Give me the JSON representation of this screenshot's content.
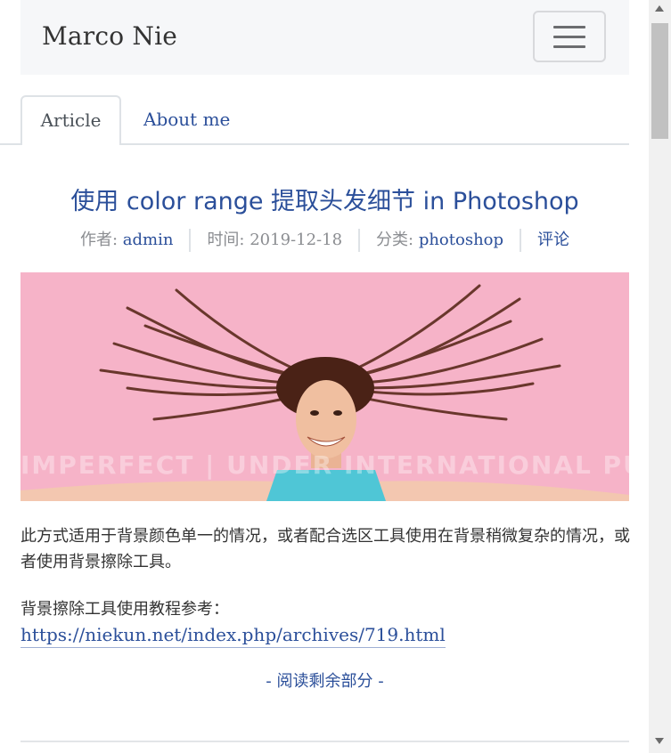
{
  "navbar": {
    "brand": "Marco Nie",
    "menu_icon": "hamburger-menu-icon"
  },
  "tabs": [
    {
      "label": "Article",
      "active": true
    },
    {
      "label": "About me",
      "active": false
    }
  ],
  "post": {
    "title": "使用 color range 提取头发细节 in Photoshop",
    "meta": {
      "author_label": "作者: ",
      "author": "admin",
      "date_label": "时间: ",
      "date": "2019-12-18",
      "category_label": "分类: ",
      "category": "photoshop",
      "comments": "评论"
    },
    "image": {
      "description_icon": "hero-photo",
      "watermark": "IMPERFECT | UNDER INTERNATIONAL PUR"
    },
    "paragraph1": "此方式适用于背景颜色单一的情况，或者配合选区工具使用在背景稍微复杂的情况，或者使用背景擦除工具。",
    "paragraph2": "背景擦除工具使用教程参考：",
    "link": "https://niekun.net/index.php/archives/719.html",
    "read_more": "- 阅读剩余部分 -"
  },
  "colors": {
    "link": "#2b4f9a",
    "navbar_bg": "#f6f7f9",
    "hero_bg": "#f6b3c8"
  }
}
